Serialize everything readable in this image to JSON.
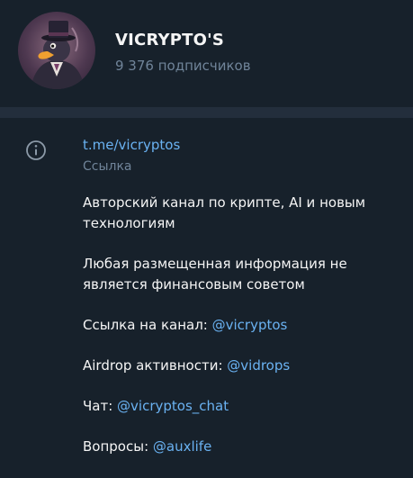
{
  "channel": {
    "title": "VICRYPTO'S",
    "subscribers": "9 376 подписчиков",
    "avatar_icon": "duck-in-top-hat-avatar"
  },
  "info": {
    "icon": "info-icon",
    "link": "t.me/vicryptos",
    "link_caption": "Ссылка",
    "description": {
      "line1": "Авторский канал по крипте, AI и новым технологиям",
      "line2": "Любая размещенная информация не является финансовым советом",
      "channel_label": "Ссылка на канал: ",
      "channel_handle": "@vicryptos",
      "airdrop_label": "Airdrop активности: ",
      "airdrop_handle": "@vidrops",
      "chat_label": "Чат: ",
      "chat_handle": "@vicryptos_chat",
      "questions_label": "Вопросы: ",
      "questions_handle": "@auxlife"
    }
  },
  "colors": {
    "background": "#17212b",
    "divider": "#232e3c",
    "link": "#6ab2f2",
    "muted": "#708499",
    "text": "#f5f5f5"
  }
}
